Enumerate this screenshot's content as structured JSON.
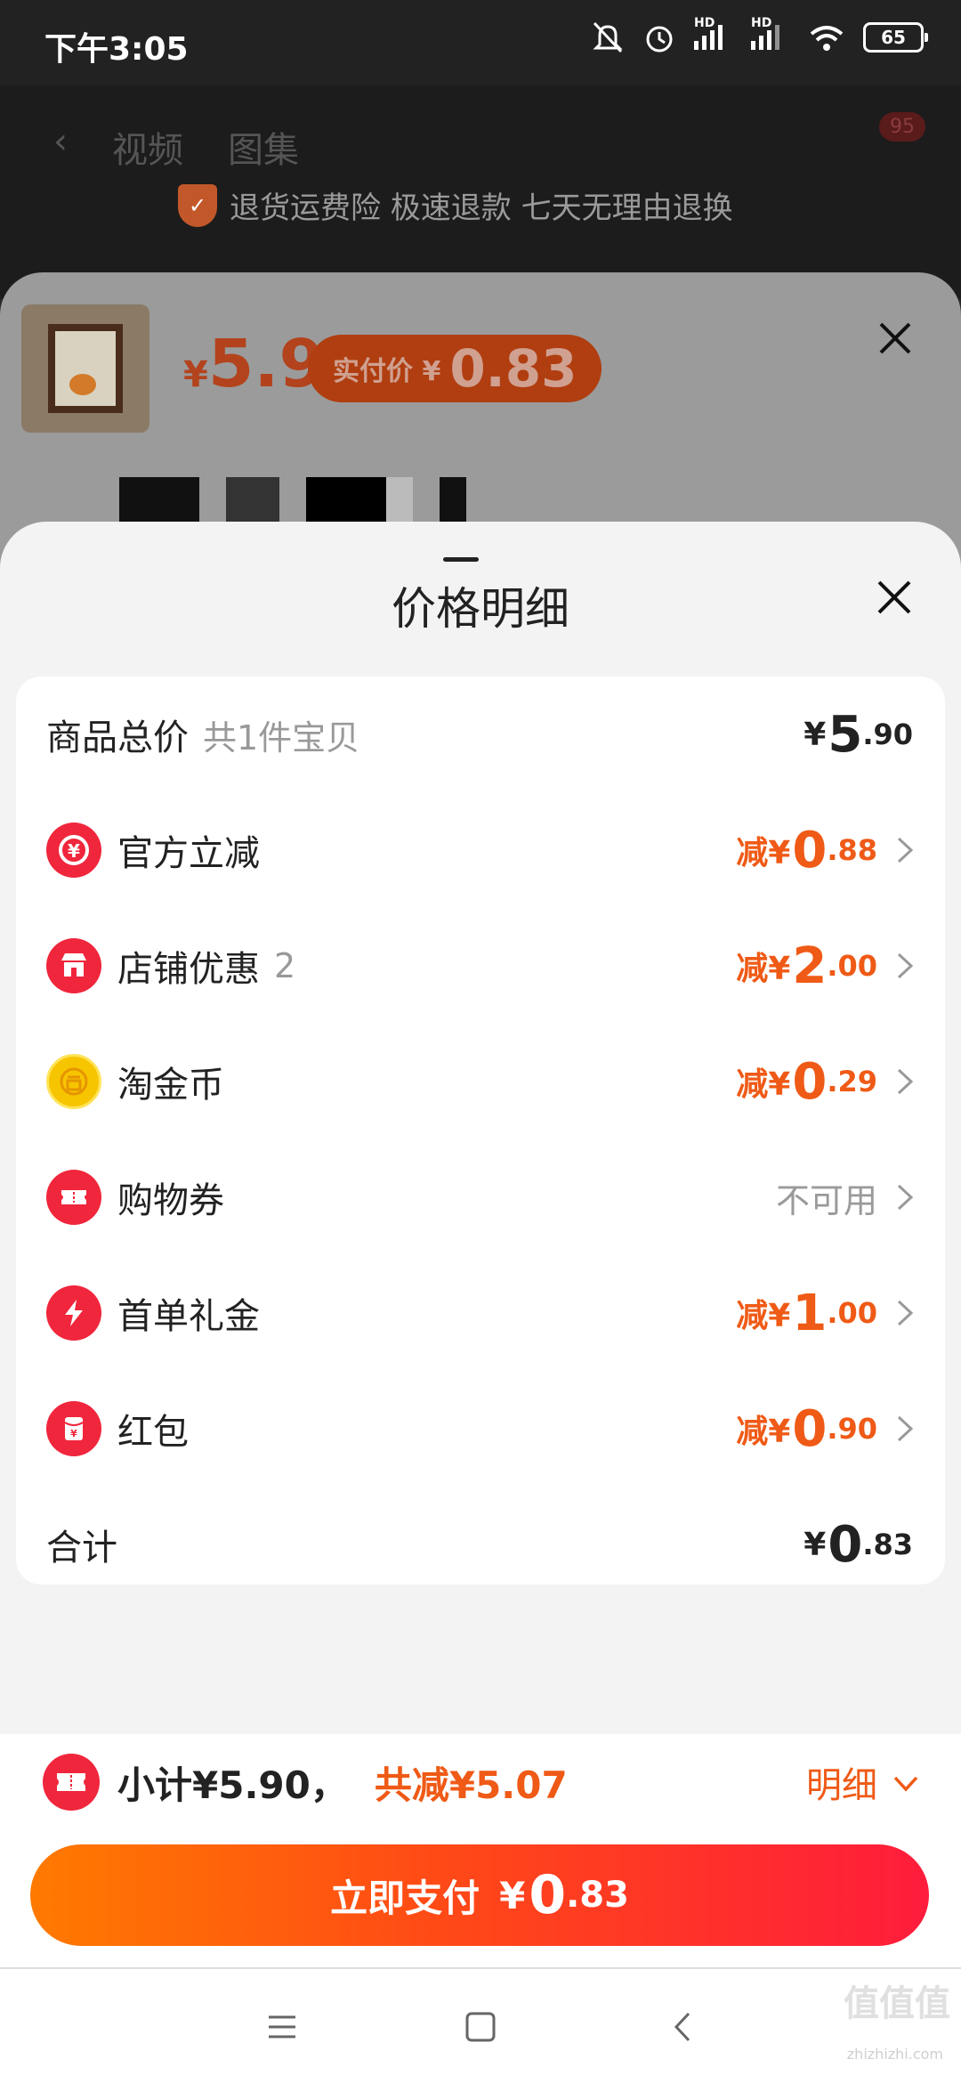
{
  "status_bar": {
    "time": "下午3:05",
    "battery": "65",
    "hd": "HD"
  },
  "background_page": {
    "nav_tabs": [
      "视频",
      "图集"
    ],
    "cart_badge": "95",
    "guarantee_text": "退货运费险 极速退款 七天无理由退换"
  },
  "sku_panel": {
    "price_symbol": "¥",
    "price": "5.9",
    "real_pay_label": "实付价 ¥",
    "real_pay_value": "0.83"
  },
  "price_detail": {
    "title": "价格明细",
    "total_row": {
      "label": "商品总价",
      "sub": "共1件宝贝",
      "prefix": "¥",
      "int": "5",
      "dec": ".90"
    },
    "discount_rows": [
      {
        "label": "官方立减",
        "sub": "",
        "icon": "yuan-coupon-icon",
        "prefix": "减¥",
        "int": "0",
        "dec": ".88"
      },
      {
        "label": "店铺优惠",
        "sub": "2",
        "icon": "store-icon",
        "prefix": "减¥",
        "int": "2",
        "dec": ".00"
      },
      {
        "label": "淘金币",
        "sub": "",
        "icon": "gold-coin-icon",
        "prefix": "减¥",
        "int": "0",
        "dec": ".29"
      },
      {
        "label": "购物券",
        "sub": "",
        "icon": "ticket-icon",
        "unavailable": "不可用"
      },
      {
        "label": "首单礼金",
        "sub": "",
        "icon": "lightning-icon",
        "prefix": "减¥",
        "int": "1",
        "dec": ".00"
      },
      {
        "label": "红包",
        "sub": "",
        "icon": "red-envelope-icon",
        "prefix": "减¥",
        "int": "0",
        "dec": ".90"
      }
    ],
    "sum_row": {
      "label": "合计",
      "prefix": "¥",
      "int": "0",
      "dec": ".83"
    }
  },
  "bottom_bar": {
    "subtotal": "小计¥5.90，",
    "discount_total": "共减¥5.07",
    "detail_label": "明细",
    "pay_label": "立即支付",
    "pay_prefix": "¥",
    "pay_int": "0",
    "pay_dec": ".83"
  },
  "watermark": {
    "logo": "值值值",
    "site": "zhizhizhi.com"
  },
  "colors": {
    "accent": "#ef5a16",
    "brand_red": "#f0263c",
    "gold": "#f7c500"
  }
}
